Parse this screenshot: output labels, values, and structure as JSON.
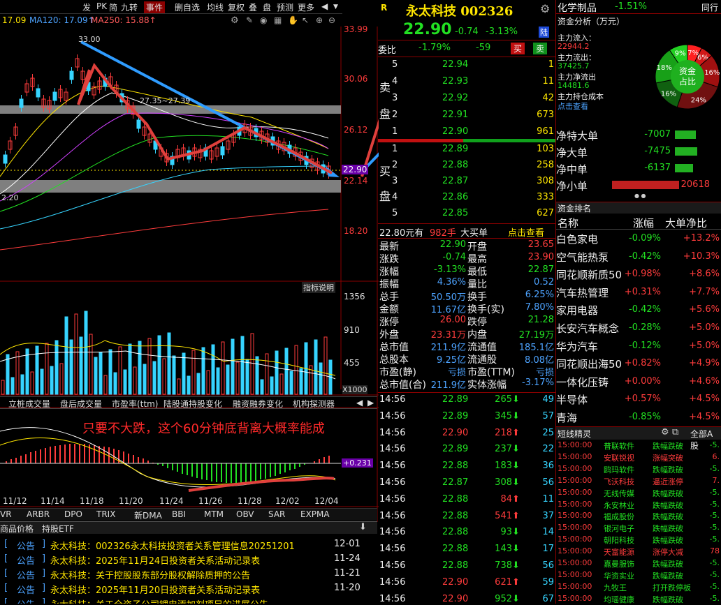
{
  "toolbar": {
    "items": [
      "发",
      "PK",
      "简",
      "九转",
      "事件",
      "删自选",
      "均线",
      "复权",
      "叠",
      "盘",
      "预测",
      "更多"
    ]
  },
  "ma_legend": {
    "p1": "17.09",
    "ma120": "MA120: 17.09↑",
    "ma250": "MA250: 15.88↑"
  },
  "price_axis": [
    "33.99",
    "30.06",
    "26.12",
    "22.90",
    "22.14",
    "18.20"
  ],
  "vol_axis": [
    "1356",
    "910",
    "455",
    "X1000"
  ],
  "chart_labels": {
    "high": "33.00",
    "mid": "27.35~27.39",
    "low": "2.20",
    "zero": "+0.231",
    "indicator_btn": "指标说明"
  },
  "date_axis": [
    "11/12",
    "11/14",
    "11/18",
    "11/20",
    "11/24",
    "11/26",
    "11/28",
    "12/02",
    "12/04"
  ],
  "sub_tabs": [
    "立桩成交量",
    "盘后成交量",
    "市盈率(ttm)",
    "陆股通持股变化",
    "融资融券变化",
    "机构探测器"
  ],
  "annotation": "只要不大跌，这个60分钟底背离大概率能成",
  "ind_tabs": [
    "VR",
    "ARBR",
    "DPO",
    "TRIX",
    "新DMA",
    "BBI",
    "MTM",
    "OBV",
    "SAR",
    "EXPMA"
  ],
  "news_tabs": [
    "商品价格",
    "持股ETF"
  ],
  "news": [
    {
      "tag": "公告",
      "title": "永太科技：002326永太科技投资者关系管理信息20251201",
      "date": "12-01"
    },
    {
      "tag": "公告",
      "title": "永太科技：2025年11月24日投资者关系活动记录表",
      "date": "11-24"
    },
    {
      "tag": "公告",
      "title": "永太科技：关于控股股东部分股权解除质押的公告",
      "date": "11-21"
    },
    {
      "tag": "公告",
      "title": "永太科技：2025年11月20日投资者关系活动记录表",
      "date": "11-20"
    },
    {
      "tag": "公告",
      "title": "永太科技：关于全资子公司锂电添加剂项目的进展公告",
      "date": ""
    }
  ],
  "quote": {
    "r": "R",
    "name": "永太科技 002326",
    "price": "22.90",
    "chg": "-0.74",
    "pct": "-3.13%",
    "tag": "陆",
    "weibi_label": "委比",
    "weibi": "-1.79%",
    "weicha": "-59",
    "buy": "买",
    "sell": "卖"
  },
  "asks": [
    {
      "lv": "5",
      "p": "22.94",
      "v": "1"
    },
    {
      "lv": "4",
      "p": "22.93",
      "v": "11"
    },
    {
      "lv": "3",
      "p": "22.92",
      "v": "42"
    },
    {
      "lv": "2",
      "p": "22.91",
      "v": "673"
    },
    {
      "lv": "1",
      "p": "22.90",
      "v": "961"
    }
  ],
  "bids": [
    {
      "lv": "1",
      "p": "22.89",
      "v": "103"
    },
    {
      "lv": "2",
      "p": "22.88",
      "v": "258"
    },
    {
      "lv": "3",
      "p": "22.87",
      "v": "308"
    },
    {
      "lv": "4",
      "p": "22.86",
      "v": "333"
    },
    {
      "lv": "5",
      "p": "22.85",
      "v": "627"
    }
  ],
  "side_labels": {
    "sell1": "卖",
    "sell2": "盘",
    "buy1": "买",
    "buy2": "盘"
  },
  "big": {
    "price": "22.80元有",
    "qty": "982手",
    "label": "大买单",
    "link": "点击查看"
  },
  "stats": [
    [
      "最新",
      "22.90",
      "开盘",
      "23.65"
    ],
    [
      "涨跌",
      "-0.74",
      "最高",
      "23.90"
    ],
    [
      "涨幅",
      "-3.13%",
      "最低",
      "22.87"
    ],
    [
      "振幅",
      "4.36%",
      "量比",
      "0.52"
    ],
    [
      "总手",
      "50.50万",
      "换手",
      "6.25%"
    ],
    [
      "金额",
      "11.67亿",
      "换手(实)",
      "7.80%"
    ],
    [
      "涨停",
      "26.00",
      "跌停",
      "21.28"
    ],
    [
      "外盘",
      "23.31万",
      "内盘",
      "27.19万"
    ],
    [
      "总市值",
      "211.9亿",
      "流通值",
      "185.1亿"
    ],
    [
      "总股本",
      "9.25亿",
      "流通股",
      "8.08亿"
    ],
    [
      "市盈(静)",
      "亏损",
      "市盈(TTM)",
      "亏损"
    ],
    [
      "总市值(合)",
      "211.9亿",
      "实体涨幅",
      "-3.17%"
    ]
  ],
  "ticks": [
    {
      "t": "14:56",
      "p": "22.89",
      "v": "265",
      "d": "dn",
      "n": "49"
    },
    {
      "t": "14:56",
      "p": "22.89",
      "v": "345",
      "d": "dn",
      "n": "57"
    },
    {
      "t": "14:56",
      "p": "22.90",
      "v": "218",
      "d": "up",
      "n": "25"
    },
    {
      "t": "14:56",
      "p": "22.89",
      "v": "237",
      "d": "dn",
      "n": "22"
    },
    {
      "t": "14:56",
      "p": "22.88",
      "v": "183",
      "d": "dn",
      "n": "36"
    },
    {
      "t": "14:56",
      "p": "22.87",
      "v": "308",
      "d": "dn",
      "n": "56"
    },
    {
      "t": "14:56",
      "p": "22.88",
      "v": "84",
      "d": "up",
      "n": "11"
    },
    {
      "t": "14:56",
      "p": "22.88",
      "v": "541",
      "d": "up",
      "n": "37"
    },
    {
      "t": "14:56",
      "p": "22.88",
      "v": "93",
      "d": "dn",
      "n": "14"
    },
    {
      "t": "14:56",
      "p": "22.88",
      "v": "143",
      "d": "dn",
      "n": "17"
    },
    {
      "t": "14:56",
      "p": "22.88",
      "v": "738",
      "d": "dn",
      "n": "56"
    },
    {
      "t": "14:56",
      "p": "22.90",
      "v": "621",
      "d": "up",
      "n": "59"
    },
    {
      "t": "14:56",
      "p": "22.90",
      "v": "952",
      "d": "dn",
      "n": "67"
    }
  ],
  "sector": {
    "name": "化学制品",
    "pct": "-1.51%",
    "right": "同行"
  },
  "fund": {
    "title": "资金分析（万元）",
    "in_l": "主力流入：",
    "in": "22944.2",
    "out_l": "主力流出：",
    "out": "37425.7",
    "net_l": "主力净流出",
    "net": "14481.6",
    "cost_l": "主力持仓成本",
    "link": "点击查看",
    "center1": "资金",
    "center2": "占比",
    "pcts": [
      "7%",
      "6%",
      "16%",
      "24%",
      "16%",
      "18%",
      "9%"
    ],
    "colors": {
      "in": "#ff2020",
      "out": "#18c018"
    }
  },
  "net_rows": [
    {
      "label": "净特大单",
      "val": "-7007",
      "bar": 0.34,
      "c": "g"
    },
    {
      "label": "净大单",
      "val": "-7475",
      "bar": 0.36,
      "c": "g"
    },
    {
      "label": "净中单",
      "val": "-6137",
      "bar": 0.3,
      "c": "g"
    },
    {
      "label": "净小单",
      "val": "20618",
      "bar": 1.0,
      "c": "r"
    }
  ],
  "rank": {
    "title": "资金排名",
    "h1": "名称",
    "h2": "涨幅",
    "h3": "大单净比",
    "rows": [
      [
        "白色家电",
        "-0.09%",
        "+13.2%"
      ],
      [
        "空气能热泵",
        "-0.42%",
        "+10.3%"
      ],
      [
        "同花顺新质50",
        "+0.98%",
        "+8.6%"
      ],
      [
        "汽车热管理",
        "+0.31%",
        "+7.7%"
      ],
      [
        "家用电器",
        "-0.42%",
        "+5.6%"
      ],
      [
        "长安汽车概念",
        "-0.28%",
        "+5.0%"
      ],
      [
        "华为汽车",
        "-0.12%",
        "+5.0%"
      ],
      [
        "同花顺出海50",
        "+0.82%",
        "+4.9%"
      ],
      [
        "一体化压铸",
        "+0.00%",
        "+4.6%"
      ],
      [
        "半导体",
        "+0.57%",
        "+4.5%"
      ],
      [
        "青海",
        "-0.85%",
        "+4.5%"
      ]
    ]
  },
  "short": {
    "title": "短线精灵",
    "right": "全部A股",
    "rows": [
      [
        "15:00:00",
        "普联软件",
        "跌幅跌破",
        "-5."
      ],
      [
        "15:00:00",
        "安联锐视",
        "涨幅突破",
        "6."
      ],
      [
        "15:00:00",
        "鸥玛软件",
        "跌幅跌破",
        "-5."
      ],
      [
        "15:00:00",
        "飞沃科技",
        "逼近涨停",
        "7."
      ],
      [
        "15:00:00",
        "无线传媒",
        "跌幅跌破",
        "-5."
      ],
      [
        "15:00:00",
        "永安林业",
        "跌幅跌破",
        "-5."
      ],
      [
        "15:00:00",
        "福成股份",
        "跌幅跌破",
        "-5."
      ],
      [
        "15:00:00",
        "银河电子",
        "跌幅跌破",
        "-5."
      ],
      [
        "15:00:00",
        "朝阳科技",
        "跌幅跌破",
        "-5."
      ],
      [
        "15:00:00",
        "天富能源",
        "涨停大减",
        "78"
      ],
      [
        "15:00:00",
        "嘉曼服饰",
        "跌幅跌破",
        "-5."
      ],
      [
        "15:00:00",
        "华资实业",
        "跌幅跌破",
        "-5."
      ],
      [
        "15:00:00",
        "九牧王",
        "打开跌停板",
        "-5."
      ],
      [
        "15:00:00",
        "均瑶健康",
        "跌幅跌破",
        "-5."
      ]
    ]
  }
}
